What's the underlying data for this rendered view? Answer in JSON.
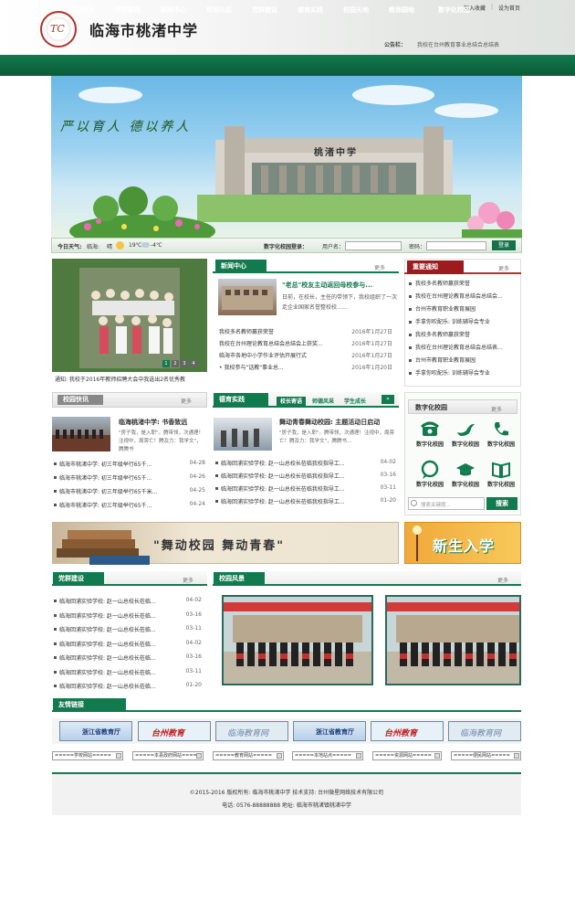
{
  "header": {
    "school_name": "临海市桃渚中学",
    "links": [
      "加入收藏",
      "|",
      "设为首页"
    ],
    "announce_label": "公告栏：",
    "announce_text": "我校在台州教育事业总结合总结表"
  },
  "nav": {
    "items": [
      "网站首页",
      "学校概括",
      "新闻中心",
      "师资队伍",
      "党群建设",
      "德育实践",
      "校园天地",
      "教师园地",
      "数字化校园"
    ]
  },
  "banner": {
    "slogan": "严以育人  德以养人",
    "gate_sign": "桃渚中学"
  },
  "weather": {
    "label": "今日天气:",
    "city": "临海:",
    "cond": "晴",
    "temp_high": "19℃",
    "temp_low": "-4℃",
    "login_label": "数字化校园登录：",
    "user_label": "用户名：",
    "pwd_label": "密码：",
    "login_button": "登录"
  },
  "photo": {
    "caption": "通知: 我校于2016年教师招聘大会中我选出2名优秀教",
    "pager": [
      "1",
      "2",
      "3",
      "4"
    ]
  },
  "news": {
    "title": "新闻中心",
    "more": "更多",
    "headline": "\"老总\"校友主动返回母校参与...",
    "headline_text": "日前，在校长，主任的带领下，我校组织了一次走企业国家名誉整校校……",
    "items": [
      {
        "text": "我校多名教师赢获荣誉",
        "date": "2016年1月27日"
      },
      {
        "text": "我校在台州理论教育总结会总结会上获奖...",
        "date": "2016年1月27日"
      },
      {
        "text": "临海市各地中小学作业评估开展行式",
        "date": "2016年1月27日"
      },
      {
        "text": "• 我校参与\"话教\"事业总...",
        "date": "2016年1月20日"
      }
    ]
  },
  "notice": {
    "title": "重要通知",
    "more": "更多",
    "items": [
      "我校多名教师赢获荣誉",
      "我校在台州理论教育总结会总结会...",
      "台州市教育职业教育展园",
      "手拿你吹配乐: 训练辅导会专业",
      "我校多名教师赢获荣誉",
      "我校在台州理论教育总结会总结表...",
      "台州市教育职业教育展园",
      "手拿你吹配乐: 训练辅导会专业"
    ]
  },
  "campus_news": {
    "title": "校园快讯",
    "more": "更多",
    "head_title": "临海桃渚中学: 书香致远",
    "head_text": "\"房子我，是入职\"。腾带领，次通理！注视中，周旁亡！腾及力：我学文\"，腾腾书",
    "items": [
      {
        "text": "临海市桃渚中学: 初三年级举行65千...",
        "date": "04-28"
      },
      {
        "text": "临海市桃渚中学: 初三年级举行65千...",
        "date": "04-26"
      },
      {
        "text": "临海市桃渚中学: 初三年级举行65千米...",
        "date": "04-25"
      },
      {
        "text": "临海市桃渚中学: 初三年级举行65千...",
        "date": "04-24"
      }
    ]
  },
  "moral": {
    "title": "德育实践",
    "tabs": [
      "校长寄语",
      "师德风采",
      "学生成长"
    ],
    "head_title": "舞动青春舞动校园: 主题活动日启动",
    "head_text": "\"房子我，是入职\"。腾带领，次通理！注视中，周旁亡！腾及力：我学文\"，腾腾书…",
    "items": [
      {
        "text": "临海回浦实验学校: 赵一山总校长莅临我校指导工...",
        "date": "04-02"
      },
      {
        "text": "临海回浦实验学校: 赵一山总校长莅临我校指导工...",
        "date": "03-16"
      },
      {
        "text": "临海回浦实验学校: 赵一山总校长莅临我校指导工...",
        "date": "03-11"
      },
      {
        "text": "临海回浦实验学校: 赵一山总校长莅临我校指导工...",
        "date": "01-20"
      }
    ]
  },
  "digital": {
    "title": "数字化校园",
    "more": "更多",
    "icons": [
      {
        "label": "数字化校园",
        "icon": "phone-icon"
      },
      {
        "label": "数字化校园",
        "icon": "bird-icon"
      },
      {
        "label": "数字化校园",
        "icon": "handset-icon"
      },
      {
        "label": "数字化校园",
        "icon": "chat-icon"
      },
      {
        "label": "数字化校园",
        "icon": "graduation-cap-icon"
      },
      {
        "label": "数字化校园",
        "icon": "book-icon"
      }
    ],
    "search_placeholder": "搜索关键题...",
    "search_button": "搜索"
  },
  "ad": {
    "text": "\"舞动校园  舞动青春\"",
    "enroll": "新生入学"
  },
  "party": {
    "title": "党群建设",
    "more": "更多",
    "items": [
      {
        "text": "临海回浦实验学校: 赵一山总校长莅临...",
        "date": "04-02"
      },
      {
        "text": "临海回浦实验学校: 赵一山总校长莅临...",
        "date": "03-16"
      },
      {
        "text": "临海回浦实验学校: 赵一山总校长莅临...",
        "date": "03-11"
      },
      {
        "text": "临海回浦实验学校: 赵一山总校长莅临...",
        "date": "04-02"
      },
      {
        "text": "临海回浦实验学校: 赵一山总校长莅临...",
        "date": "03-16"
      },
      {
        "text": "临海回浦实验学校: 赵一山总校长莅临...",
        "date": "03-11"
      },
      {
        "text": "临海回浦实验学校: 赵一山总校长莅临...",
        "date": "01-20"
      }
    ]
  },
  "scenery": {
    "title": "校园风景",
    "more": "更多"
  },
  "links": {
    "title": "友情链接",
    "banners": [
      "浙江省教育厅",
      "台州教育",
      "临海教育网",
      "浙江省教育厅",
      "台州教育",
      "临海教育网"
    ],
    "selects": [
      "=====学校网站=====",
      "=====本县政府网站=====",
      "=====教育网站=====",
      "=====本地站点=====",
      "=====资源网站=====",
      "=====便民网站====="
    ]
  },
  "footer": {
    "line1": "©2015-2016  版权所有: 临海市桃渚中学      技术支持: 台州微星网络技术有限公司",
    "line2": "电话: 0576-88888888   地址: 临海市桃渚镇桃渚中学"
  },
  "colors": {
    "green": "#127a4f",
    "red": "#b0322b"
  }
}
